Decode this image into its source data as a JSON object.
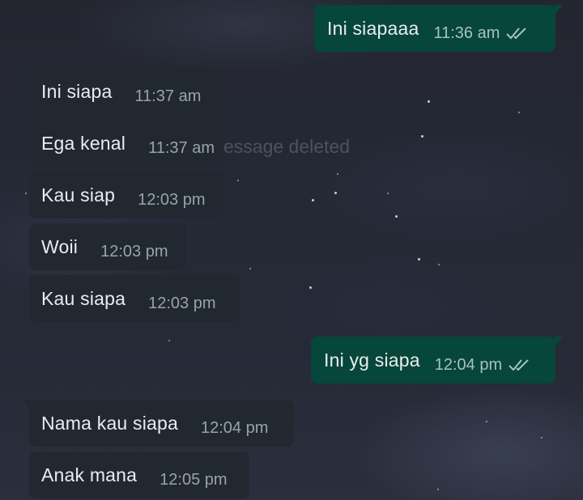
{
  "colors": {
    "incoming_bubble": "#222830",
    "outgoing_bubble": "#07463a",
    "message_text": "#e9edef",
    "time_text": "#9aa3a9",
    "read_ticks": "#a7c3bb"
  },
  "deleted_notice": "essage deleted",
  "messages": [
    {
      "direction": "outgoing",
      "text": "Ini siapaaa",
      "time": "11:36 am",
      "status_icon": "double-check-icon"
    },
    {
      "direction": "incoming",
      "text": "Ini siapa",
      "time": "11:37 am"
    },
    {
      "direction": "incoming",
      "text": "Ega kenal",
      "time": "11:37 am"
    },
    {
      "direction": "incoming",
      "text": "Kau siap",
      "time": "12:03 pm"
    },
    {
      "direction": "incoming",
      "text": "Woii",
      "time": "12:03 pm"
    },
    {
      "direction": "incoming",
      "text": "Kau siapa",
      "time": "12:03 pm"
    },
    {
      "direction": "outgoing",
      "text": "Ini yg siapa",
      "time": "12:04 pm",
      "status_icon": "double-check-icon"
    },
    {
      "direction": "incoming",
      "text": "Nama kau siapa",
      "time": "12:04 pm"
    },
    {
      "direction": "incoming",
      "text": "Anak mana",
      "time": "12:05 pm"
    }
  ]
}
